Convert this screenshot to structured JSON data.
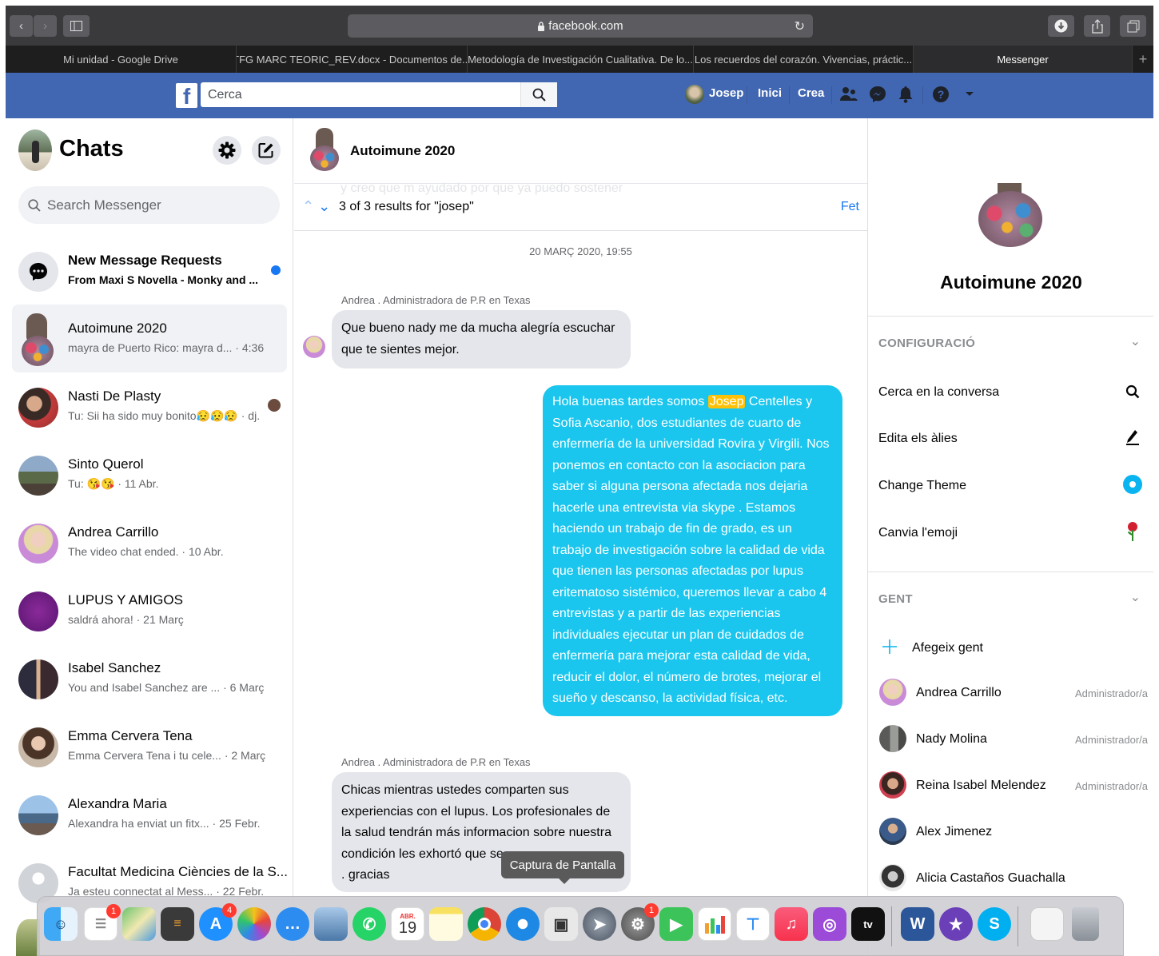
{
  "browser": {
    "url": "facebook.com",
    "tabs": [
      {
        "label": "Mi unidad - Google Drive"
      },
      {
        "label": "TFG MARC TEORIC_REV.docx - Documentos de..."
      },
      {
        "label": "Metodología de Investigación Cualitativa. De lo..."
      },
      {
        "label": "Los recuerdos del corazón. Vivencias, práctic..."
      },
      {
        "label": "Messenger"
      }
    ],
    "new_tab": "+"
  },
  "fb": {
    "logo": "f",
    "search_placeholder": "Cerca",
    "profile_name": "Josep",
    "nav_home": "Inici",
    "nav_create": "Crea",
    "icons": [
      "friends-icon",
      "messenger-icon",
      "bell-icon",
      "help-icon",
      "caret-down-icon"
    ]
  },
  "left": {
    "title": "Chats",
    "search_placeholder": "Search Messenger",
    "conversations": [
      {
        "name": "New Message Requests",
        "snippet": "From Maxi S Novella - Monky and ...",
        "bold": true,
        "unread": true
      },
      {
        "name": "Autoimune 2020",
        "snippet": "mayra de Puerto Rico: mayra d... · 4:36",
        "selected": true
      },
      {
        "name": "Nasti De Plasty",
        "snippet": "Tu: Sii ha sido muy bonito😥😥😥 · dj."
      },
      {
        "name": "Sinto Querol",
        "snippet": "Tu: 😘😘 · 11 Abr."
      },
      {
        "name": "Andrea Carrillo",
        "snippet": "The video chat ended. · 10 Abr."
      },
      {
        "name": "LUPUS Y AMIGOS",
        "snippet": "saldrá ahora! · 21 Març"
      },
      {
        "name": "Isabel Sanchez",
        "snippet": "You and Isabel Sanchez are ... · 6 Març"
      },
      {
        "name": "Emma Cervera Tena",
        "snippet": "Emma Cervera Tena i tu cele... · 2 Març"
      },
      {
        "name": "Alexandra Maria",
        "snippet": "Alexandra ha enviat un fitx... · 25 Febr."
      },
      {
        "name": "Facultat Medicina Ciències de la S...",
        "snippet": "Ja esteu connectat al Mess... · 22 Febr."
      }
    ]
  },
  "chat": {
    "group_name": "Autoimune 2020",
    "search_faded": "y creo que m ayudado por que ya puedo  sostener",
    "search_results": "3 of 3 results for \"josep\"",
    "search_done": "Fet",
    "date_divider": "20 MARÇ 2020, 19:55",
    "sender1": "Andrea . Administradora de P.R en Texas",
    "msg1": "Que bueno nady me da mucha alegría escuchar que te sientes mejor.",
    "msg2_before": "Hola buenas tardes somos ",
    "msg2_highlight": "Josep",
    "msg2_after": " Centelles y Sofia Ascanio, dos estudiantes de cuarto de enfermería de la universidad Rovira y Virgili. Nos ponemos en contacto con la asociacion para saber si alguna persona afectada nos dejaria hacerle una entrevista via skype . Estamos haciendo un trabajo de fin de grado, es un trabajo de investigación sobre la calidad de vida que tienen las personas afectadas por lupus eritematoso sistémico, queremos llevar a cabo 4 entrevistas y a partir de las experiencias individuales ejecutar un plan de cuidados de enfermería para mejorar esta calidad de vida, reducir el dolor, el número de brotes, mejorar el sueño y descanso, la actividad física, etc.",
    "sender2": "Andrea . Administradora de P.R en Texas",
    "msg3": "Chicas mientras ustedes comparten sus experiencias con el lupus. Los profesionales de la salud tendrán más informacion sobre nuestra condición les exhortó que se",
    "msg3_tail": ". gracias",
    "tooltip": "Captura de Pantalla"
  },
  "info": {
    "name": "Autoimune 2020",
    "section_settings": "CONFIGURACIÓ",
    "items": [
      {
        "label": "Cerca en la conversa",
        "icon": "search-icon"
      },
      {
        "label": "Edita els àlies",
        "icon": "edit-icon"
      },
      {
        "label": "Change Theme",
        "icon": "theme-icon"
      },
      {
        "label": "Canvia l'emoji",
        "icon": "rose-icon"
      }
    ],
    "section_people": "GENT",
    "add_people": "Afegeix gent",
    "people": [
      {
        "name": "Andrea Carrillo",
        "role": "Administrador/a"
      },
      {
        "name": "Nady Molina",
        "role": "Administrador/a"
      },
      {
        "name": "Reina Isabel Melendez",
        "role": "Administrador/a"
      },
      {
        "name": "Alex Jimenez",
        "role": ""
      },
      {
        "name": "Alicia Castaños Guachalla",
        "role": ""
      }
    ]
  },
  "dock": {
    "calendar_month": "ABR.",
    "calendar_day": "19",
    "reminders_badge": "1",
    "appstore_badge": "4",
    "prefs_badge": "1"
  }
}
